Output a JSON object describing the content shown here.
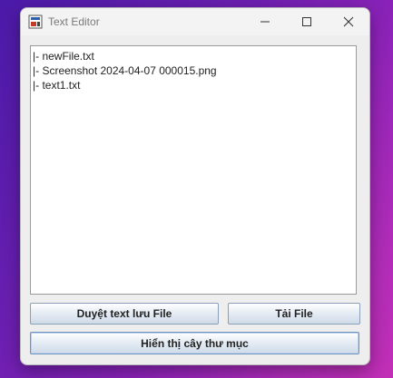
{
  "window": {
    "title": "Text Editor"
  },
  "titlebar_controls": {
    "minimize_icon": "minimize-icon",
    "maximize_icon": "maximize-icon",
    "close_icon": "close-icon"
  },
  "editor": {
    "lines": [
      "|- newFile.txt",
      "|- Screenshot 2024-04-07 000015.png",
      "|- text1.txt"
    ]
  },
  "buttons": {
    "browse_save_label": "Duyệt text lưu File",
    "load_label": "Tải File",
    "show_tree_label": "Hiển thị cây thư mục"
  }
}
